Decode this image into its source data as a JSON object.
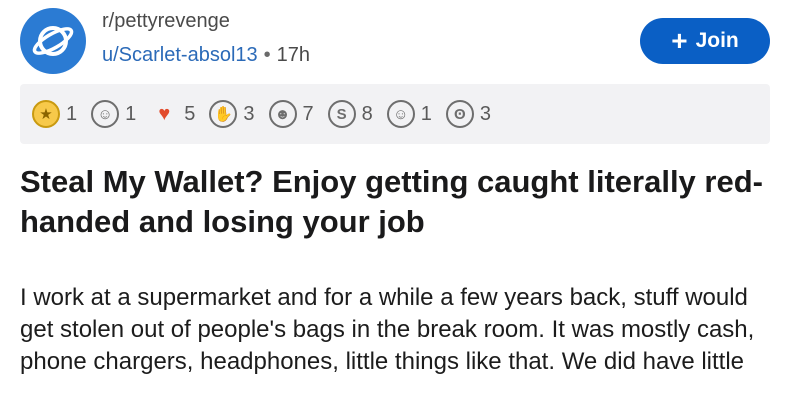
{
  "header": {
    "subreddit": "r/pettyrevenge",
    "author": "u/Scarlet-absol13",
    "separator": "•",
    "age": "17h",
    "join_label": "Join",
    "join_icon": "plus-icon",
    "colors": {
      "accent": "#0a5fc5",
      "subreddit_icon": "#2b7bd3",
      "author_link": "#2b6ab8"
    }
  },
  "awards": [
    {
      "icon": "gold-award-icon",
      "count": "1",
      "color": "#e8b60c"
    },
    {
      "icon": "wholesome-award-icon",
      "count": "1",
      "color": "#6e6e6e"
    },
    {
      "icon": "rocket-like-award-icon",
      "count": "5",
      "color": "#e24b2c"
    },
    {
      "icon": "facepalm-award-icon",
      "count": "3",
      "color": "#6e6e6e"
    },
    {
      "icon": "laughing-award-icon",
      "count": "7",
      "color": "#6e6e6e"
    },
    {
      "icon": "silver-award-icon",
      "count": "8",
      "color": "#6e6e6e"
    },
    {
      "icon": "tears-of-joy-award-icon",
      "count": "1",
      "color": "#6e6e6e"
    },
    {
      "icon": "shocked-bear-award-icon",
      "count": "3",
      "color": "#6e6e6e"
    }
  ],
  "post": {
    "title": "Steal My Wallet? Enjoy getting caught literally red-handed and losing your job",
    "body": "I work at a supermarket and for a while a few years back, stuff would get stolen out of people's bags in the break room. It was mostly cash, phone chargers, headphones, little things like that.  We did have little"
  }
}
